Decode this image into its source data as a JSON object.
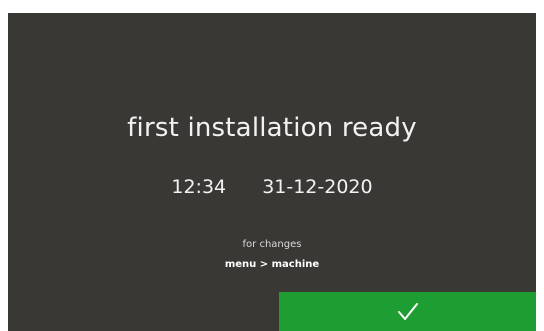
{
  "screen": {
    "title": "first installation ready",
    "time": "12:34",
    "date": "31-12-2020",
    "hint": "for changes",
    "menu_path": "menu > machine"
  },
  "confirm_button": {
    "icon": "checkmark-icon",
    "color": "#1e9e32"
  },
  "colors": {
    "background": "#3a3835",
    "text": "#f2f2f2"
  }
}
